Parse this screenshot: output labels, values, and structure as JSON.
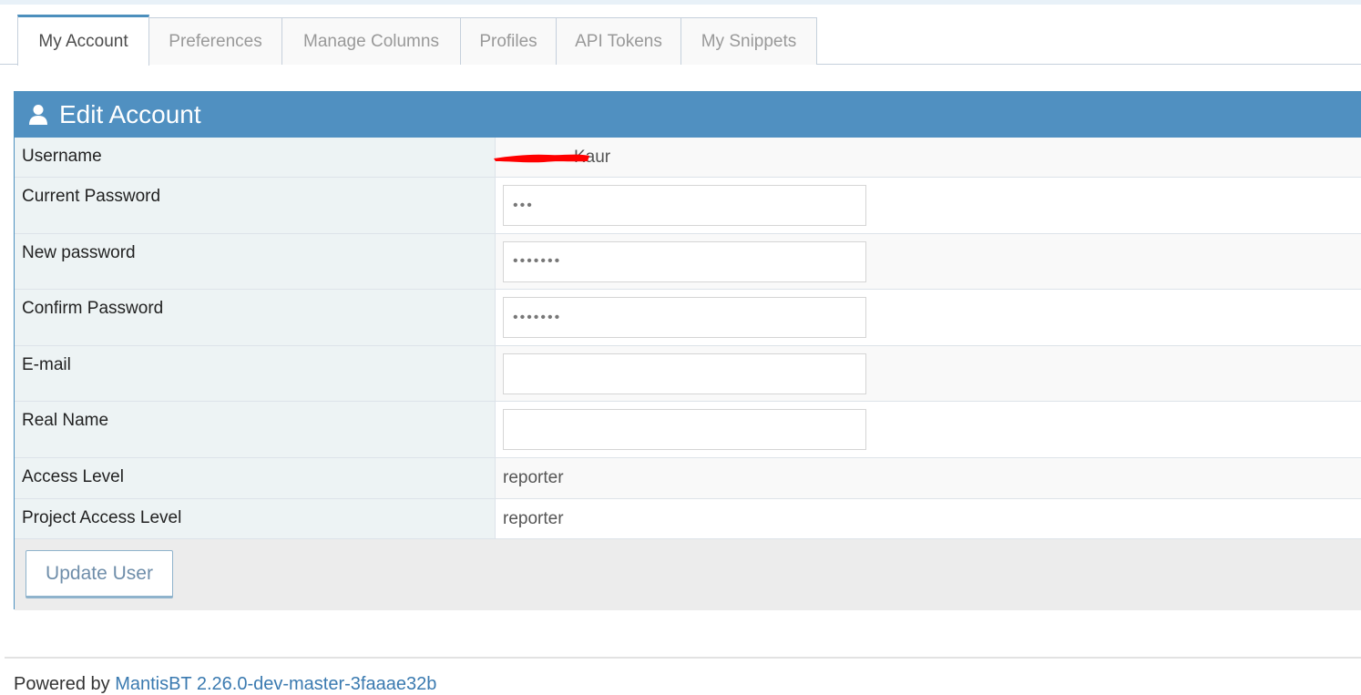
{
  "tabs": [
    {
      "label": "My Account",
      "active": true
    },
    {
      "label": "Preferences"
    },
    {
      "label": "Manage Columns"
    },
    {
      "label": "Profiles"
    },
    {
      "label": "API Tokens"
    },
    {
      "label": "My Snippets"
    }
  ],
  "panel": {
    "title": "Edit Account",
    "icon": "user-icon"
  },
  "fields": {
    "username": {
      "label": "Username",
      "value": "Kaur"
    },
    "current_password": {
      "label": "Current Password",
      "value": "•••"
    },
    "new_password": {
      "label": "New password",
      "value": "•••••••"
    },
    "confirm_password": {
      "label": "Confirm Password",
      "value": "•••••••"
    },
    "email": {
      "label": "E-mail",
      "value": ""
    },
    "real_name": {
      "label": "Real Name",
      "value": ""
    },
    "access_level": {
      "label": "Access Level",
      "value": "reporter"
    },
    "project_access_level": {
      "label": "Project Access Level",
      "value": "reporter"
    }
  },
  "actions": {
    "update_label": "Update User"
  },
  "footer": {
    "prefix": "Powered by",
    "link": "MantisBT 2.26.0-dev-master-3faaae32b"
  },
  "colors": {
    "header": "#5090c1",
    "accent": "#4c8fbd",
    "redaction": "#ff0000"
  }
}
